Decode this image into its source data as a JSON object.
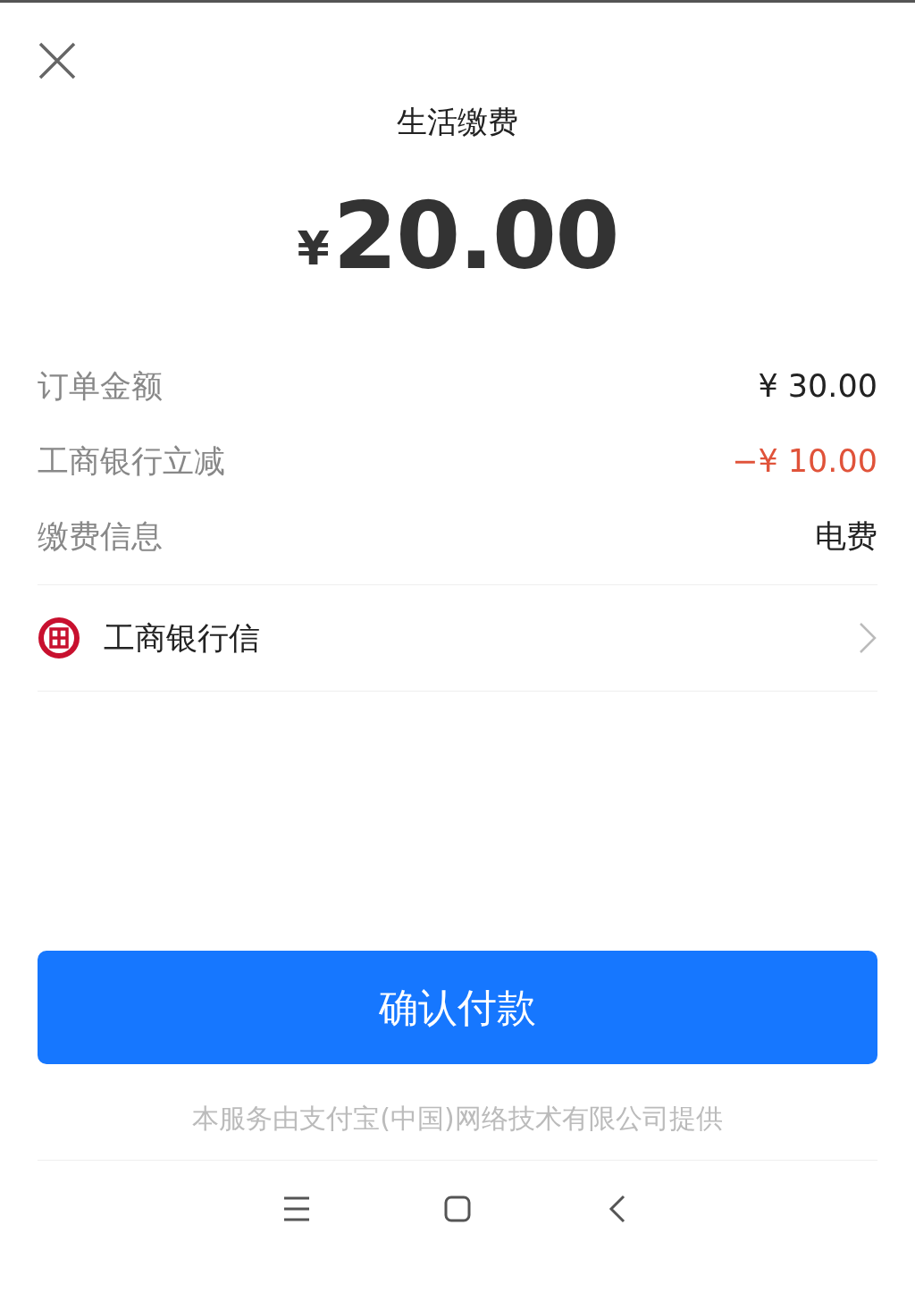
{
  "header": {
    "title": "生活缴费"
  },
  "amount": {
    "currency": "¥",
    "value": "20.00"
  },
  "details": [
    {
      "label": "订单金额",
      "value": "¥ 30.00",
      "kind": "normal"
    },
    {
      "label": "工商银行立减",
      "value": "−¥ 10.00",
      "kind": "discount"
    },
    {
      "label": "缴费信息",
      "value": "电费",
      "kind": "normal"
    }
  ],
  "payment_method": {
    "name": "工商银行信"
  },
  "confirm_button": "确认付款",
  "footer": "本服务由支付宝(中国)网络技术有限公司提供"
}
